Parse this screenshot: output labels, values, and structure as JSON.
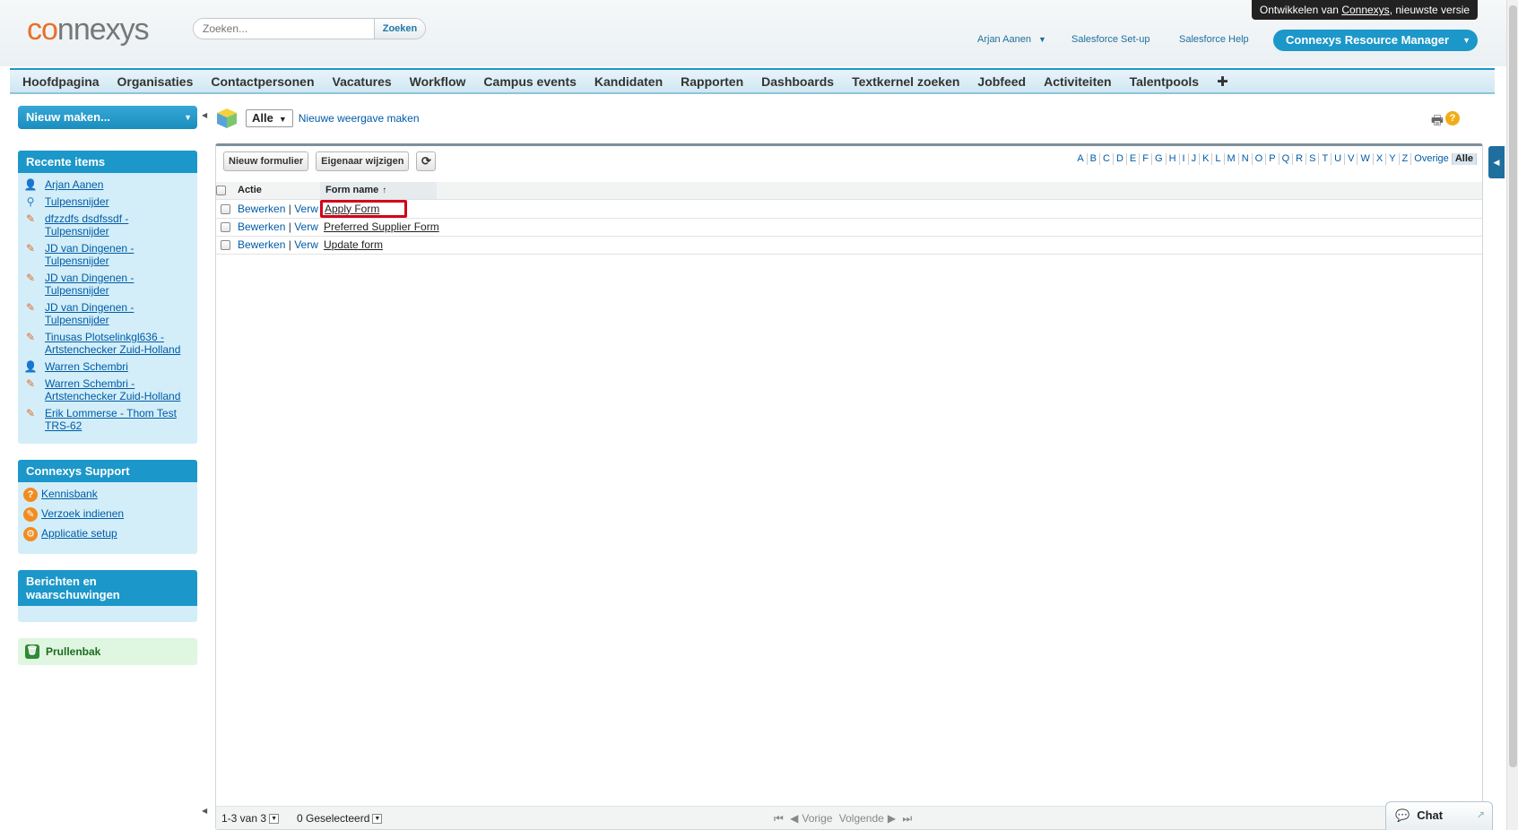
{
  "header": {
    "logo_text_accent": "co",
    "logo_text_rest": "nnexys",
    "search_placeholder": "Zoeken...",
    "search_button": "Zoeken",
    "dev_banner_prefix": "Ontwikkelen van ",
    "dev_banner_link": "Connexys",
    "dev_banner_suffix": ", nieuwste versie",
    "user_menu": "Arjan Aanen",
    "salesforce_setup": "Salesforce Set-up",
    "salesforce_help": "Salesforce Help",
    "app_switcher": "Connexys Resource Manager"
  },
  "tabs": [
    "Hoofdpagina",
    "Organisaties",
    "Contactpersonen",
    "Vacatures",
    "Workflow",
    "Campus events",
    "Kandidaten",
    "Rapporten",
    "Dashboards",
    "Textkernel zoeken",
    "Jobfeed",
    "Activiteiten",
    "Talentpools",
    "✚"
  ],
  "sidebar": {
    "new_button": "Nieuw maken...",
    "recent": {
      "title": "Recente items",
      "items": [
        {
          "icon": "person-icon",
          "line1": "Arjan Aanen",
          "line2": ""
        },
        {
          "icon": "search-icon",
          "line1": "Tulpensnijder",
          "line2": ""
        },
        {
          "icon": "pencil-icon",
          "line1": "dfzzdfs dsdfssdf -",
          "line2": "Tulpensnijder"
        },
        {
          "icon": "pencil-icon",
          "line1": "JD van Dingenen -",
          "line2": "Tulpensnijder"
        },
        {
          "icon": "pencil-icon",
          "line1": "JD van Dingenen -",
          "line2": "Tulpensnijder"
        },
        {
          "icon": "pencil-icon",
          "line1": "JD van Dingenen -",
          "line2": "Tulpensnijder"
        },
        {
          "icon": "pencil-icon",
          "line1": "Tinusas Plotselinkgl636 -",
          "line2": "Artstenchecker Zuid-Holland"
        },
        {
          "icon": "person-green-icon",
          "line1": "Warren Schembri",
          "line2": ""
        },
        {
          "icon": "pencil-icon",
          "line1": "Warren Schembri -",
          "line2": "Artstenchecker Zuid-Holland"
        },
        {
          "icon": "pencil-icon",
          "line1": "Erik Lommerse - Thom Test",
          "line2": "TRS-62"
        }
      ]
    },
    "support": {
      "title": "Connexys Support",
      "items": [
        "Kennisbank",
        "Verzoek indienen",
        "Applicatie setup"
      ]
    },
    "messages": {
      "title": "Berichten en waarschuwingen"
    },
    "trash": "Prullenbak"
  },
  "main": {
    "view_selected": "Alle",
    "new_view_link": "Nieuwe weergave maken",
    "toolbar": {
      "new_form": "Nieuw formulier",
      "change_owner": "Eigenaar wijzigen"
    },
    "alphabet": [
      "A",
      "B",
      "C",
      "D",
      "E",
      "F",
      "G",
      "H",
      "I",
      "J",
      "K",
      "L",
      "M",
      "N",
      "O",
      "P",
      "Q",
      "R",
      "S",
      "T",
      "U",
      "V",
      "W",
      "X",
      "Y",
      "Z",
      "Overige",
      "Alle"
    ],
    "alphabet_active": "Alle",
    "table": {
      "col_action": "Actie",
      "col_name": "Form name",
      "edit_label": "Bewerken",
      "delete_label": "Verw",
      "rows": [
        "Apply Form",
        "Preferred Supplier Form",
        "Update form"
      ]
    },
    "footer": {
      "range": "1-3 van 3",
      "selected": "0 Geselecteerd",
      "prev": "Vorige",
      "next": "Volgende"
    }
  },
  "chat": "Chat"
}
